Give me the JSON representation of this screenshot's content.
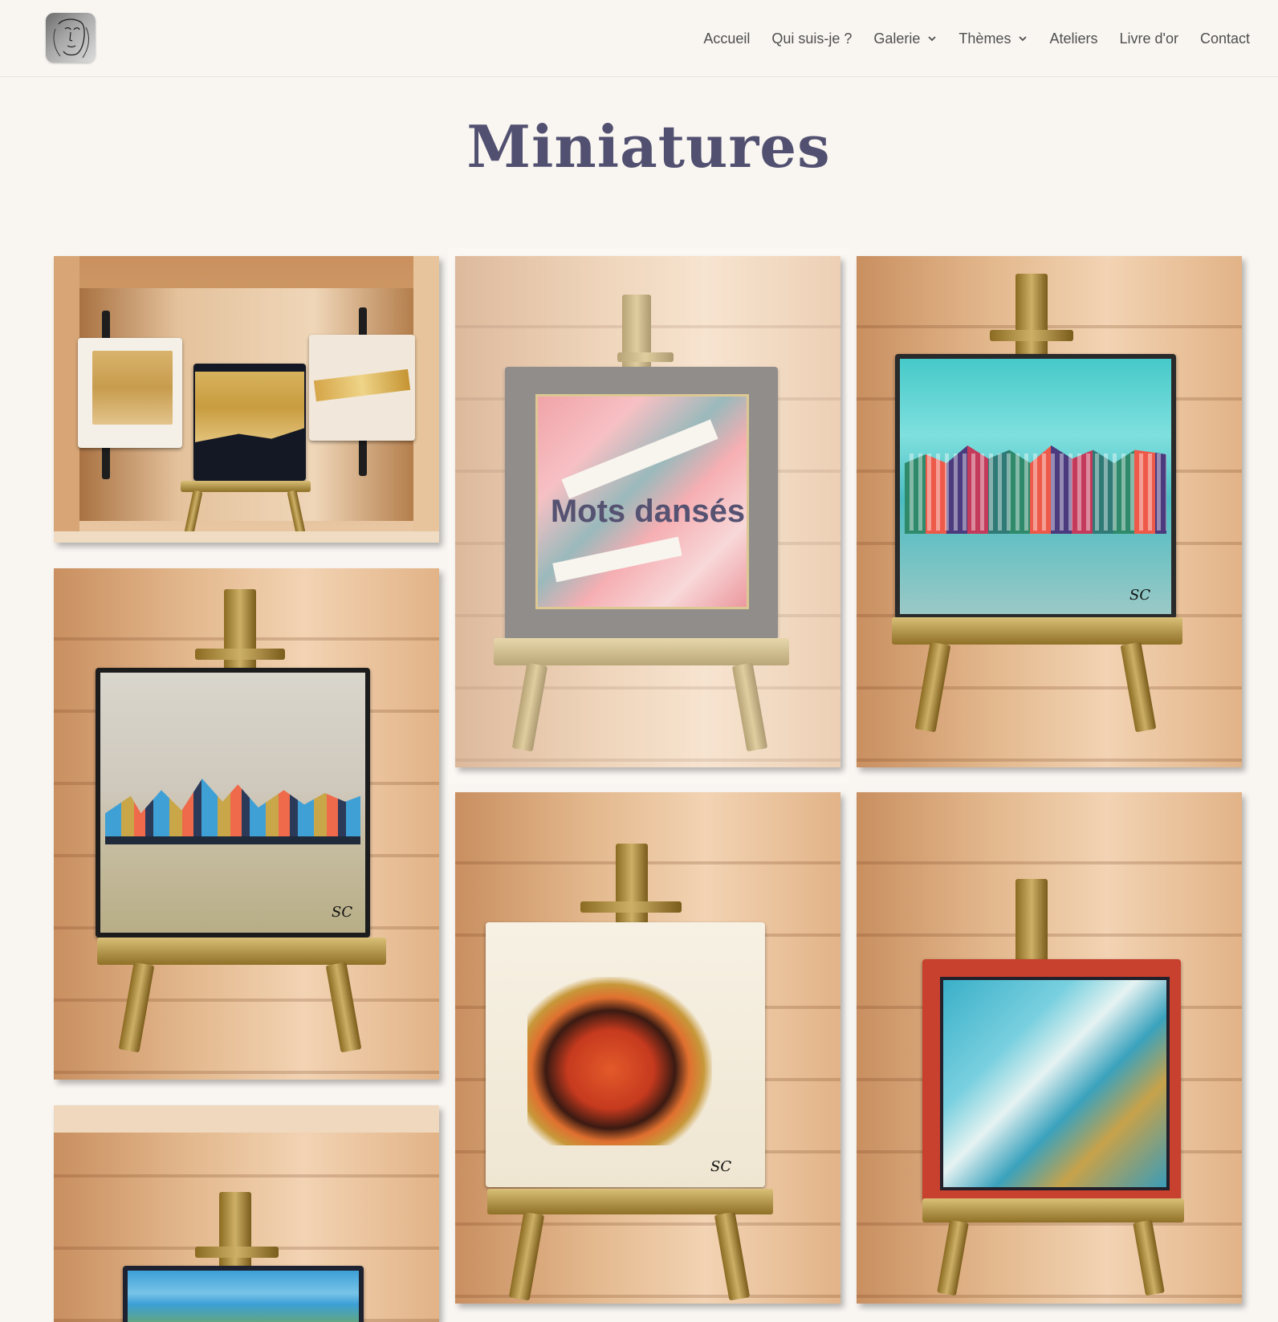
{
  "header": {
    "logo_alt": "Logo",
    "nav": [
      {
        "label": "Accueil",
        "has_dropdown": false
      },
      {
        "label": "Qui suis-je ?",
        "has_dropdown": false
      },
      {
        "label": "Galerie",
        "has_dropdown": true
      },
      {
        "label": "Thèmes",
        "has_dropdown": true
      },
      {
        "label": "Ateliers",
        "has_dropdown": false
      },
      {
        "label": "Livre d'or",
        "has_dropdown": false
      },
      {
        "label": "Contact",
        "has_dropdown": false
      }
    ]
  },
  "page": {
    "title": "Miniatures"
  },
  "gallery": {
    "featured_label": "Mots dansés",
    "signature": "SC",
    "items": [
      {
        "subject": "three gold abstract miniatures on easels"
      },
      {
        "subject": "collage canvas with dance text",
        "hover_label": "Mots dansés"
      },
      {
        "subject": "colorful canal houses with turquoise sky"
      },
      {
        "subject": "geometric city skyline"
      },
      {
        "subject": "red and orange abstract on cream"
      },
      {
        "subject": "turquoise abstract with red border"
      },
      {
        "subject": "landscape with turquoise sky"
      }
    ]
  },
  "colors": {
    "background": "#f9f6f2",
    "title": "#525070",
    "nav_text": "#4f4f4f"
  }
}
